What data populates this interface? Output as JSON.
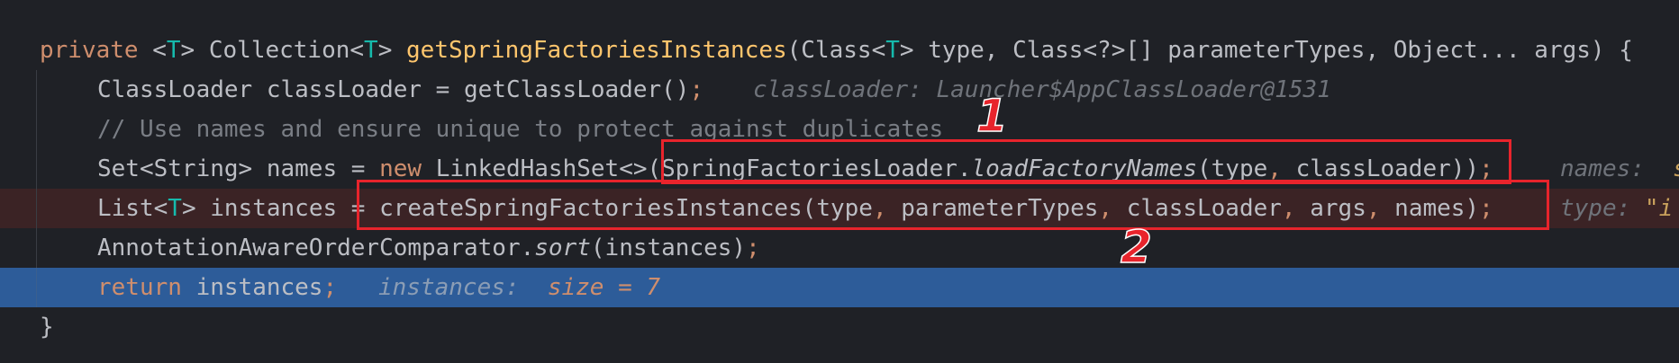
{
  "code": {
    "line1": {
      "kw_private": "private",
      "t1_open": " <",
      "t1_T": "T",
      "t1_close": "> Collection<",
      "t2_T": "T",
      "t2_close": "> ",
      "method_name": "getSpringFactoriesInstances",
      "p_open": "(Class<",
      "p_T": "T",
      "p_rest": "> type, Class<?>[] parameterTypes, Object... args) {"
    },
    "line2": {
      "code": "ClassLoader classLoader = getClassLoader()",
      "semi": ";",
      "hint": "classLoader: Launcher$AppClassLoader@1531"
    },
    "line3": {
      "comment": "// Use names and ensure unique to protect against duplicates"
    },
    "line4": {
      "a": "Set<String> names = ",
      "kw_new": "new",
      "b": " LinkedHashSet<>(SpringFactoriesLoader.",
      "method": "loadFactoryNames",
      "c": "(type",
      "comma": ",",
      "d": " classLoader))",
      "semi": ";",
      "hint_label": "names:  ",
      "hint_val": "s"
    },
    "line5": {
      "a": "List<",
      "T": "T",
      "b": "> instances = createSpringFactoriesInstances(type",
      "c1": ",",
      "d": " parameterTypes",
      "c2": ",",
      "e": " classLoader",
      "c3": ",",
      "f": " args",
      "c4": ",",
      "g": " names)",
      "semi": ";",
      "hint_label": "type: ",
      "hint_val": "\"i"
    },
    "line6": {
      "a": "AnnotationAwareOrderComparator.",
      "method": "sort",
      "b": "(instances)",
      "semi": ";"
    },
    "line7": {
      "kw_return": "return",
      "a": " instances",
      "semi": ";",
      "hint_label": "instances:  ",
      "hint_val": "size = 7"
    },
    "line8": {
      "brace": "}"
    }
  },
  "annotations": {
    "label_1": "1",
    "label_2": "2"
  },
  "colors": {
    "background": "#1f2126",
    "keyword": "#cf8e6d",
    "method_declaration": "#ffc66d",
    "type_parameter": "#16baac",
    "comment": "#7a7e85",
    "error_line_bg": "#3b2325",
    "current_line_bg": "#2d5c99",
    "annotation_red": "#e8242c"
  }
}
